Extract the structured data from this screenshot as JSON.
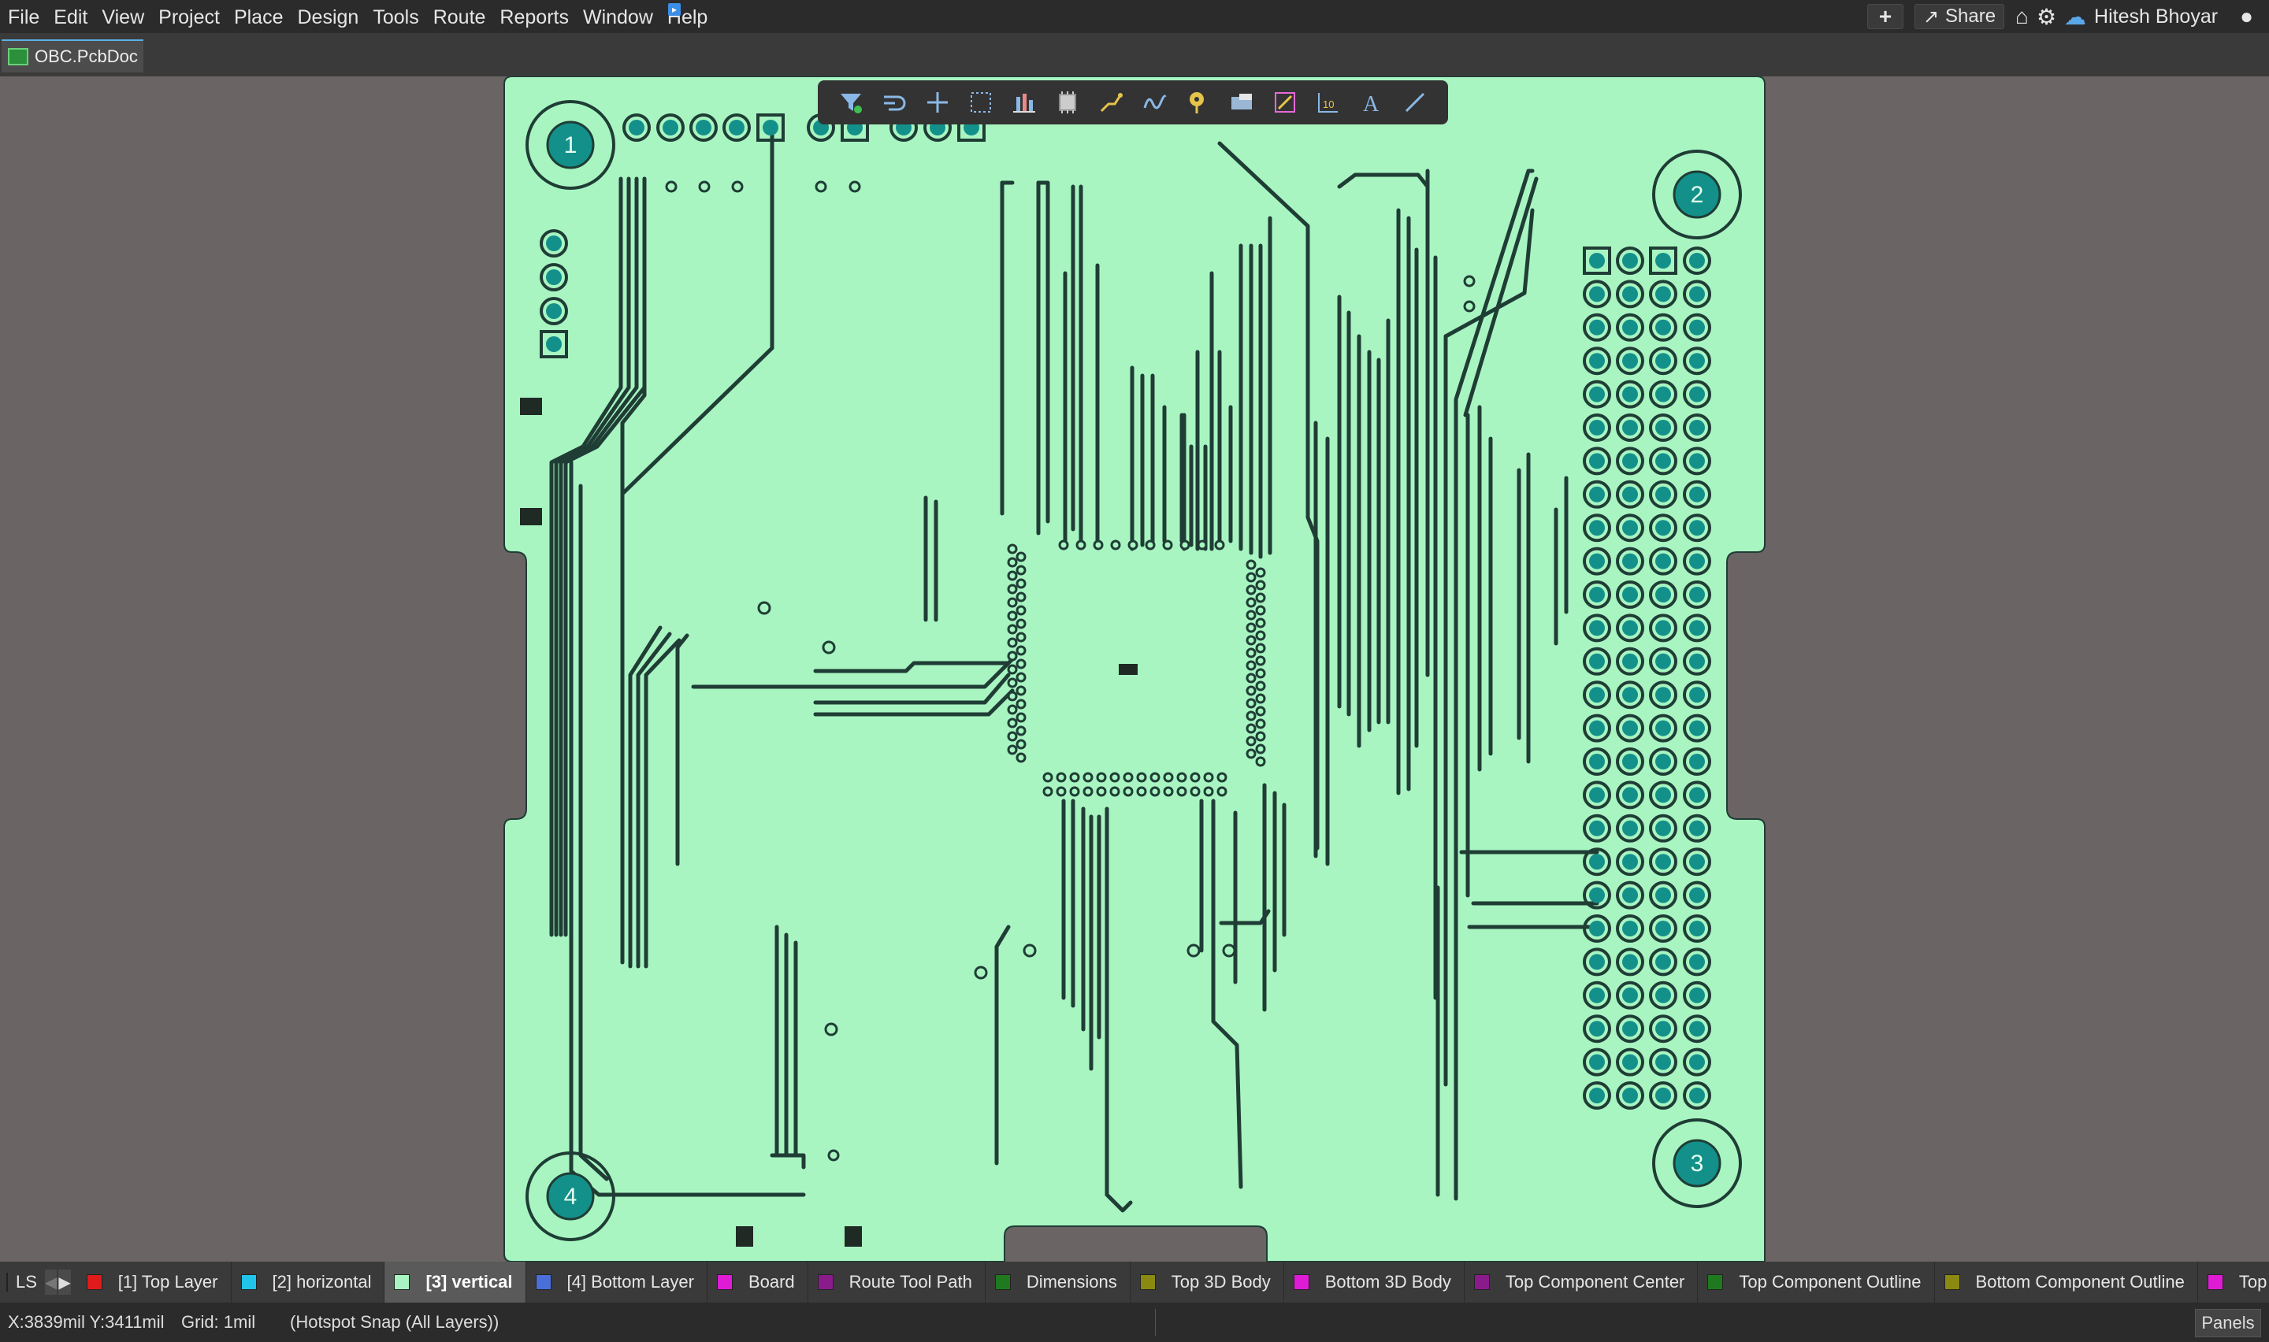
{
  "menu": {
    "items": [
      {
        "label": "File"
      },
      {
        "label": "Edit"
      },
      {
        "label": "View"
      },
      {
        "label": "Project"
      },
      {
        "label": "Place"
      },
      {
        "label": "Design"
      },
      {
        "label": "Tools"
      },
      {
        "label": "Route"
      },
      {
        "label": "Reports"
      },
      {
        "label": "Window"
      },
      {
        "label": "Help"
      }
    ]
  },
  "header_right": {
    "share_label": "Share",
    "user_name": "Hitesh Bhoyar",
    "icons": [
      "add-icon",
      "share-icon",
      "home-icon",
      "gear-icon",
      "cloud-user-icon",
      "account-icon"
    ]
  },
  "document_tab": {
    "label": "OBC.PcbDoc"
  },
  "board": {
    "mounting_holes": [
      "1",
      "2",
      "3",
      "4"
    ],
    "colors": {
      "board_fill": "#a8f5c2",
      "background": "#6b6464",
      "trace": "#1f3d35",
      "pad": "#13908a"
    }
  },
  "toolbar": {
    "tools": [
      "filter-icon",
      "interactive-route-icon",
      "cross-probe-icon",
      "select-rect-icon",
      "align-icon",
      "place-component-icon",
      "route-icon",
      "diff-pair-icon",
      "place-via-icon",
      "polygon-icon",
      "place-keepout-icon",
      "place-string-table-icon",
      "text-icon",
      "line-icon"
    ]
  },
  "layerbar": {
    "ls_label": "LS",
    "layers": [
      {
        "label": "[1] Top Layer",
        "color": "#e01b1b"
      },
      {
        "label": "[2] horizontal",
        "color": "#21c4ea"
      },
      {
        "label": "[3] vertical",
        "color": "#a8f5c2",
        "active": true
      },
      {
        "label": "[4] Bottom Layer",
        "color": "#4a6fd8"
      },
      {
        "label": "Board",
        "color": "#e01bd6"
      },
      {
        "label": "Route Tool Path",
        "color": "#8a1b8a"
      },
      {
        "label": "Dimensions",
        "color": "#1f7a1f"
      },
      {
        "label": "Top 3D Body",
        "color": "#8a8a12"
      },
      {
        "label": "Bottom 3D Body",
        "color": "#e01bd6"
      },
      {
        "label": "Top Component Center",
        "color": "#8a1b8a"
      },
      {
        "label": "Top Component Outline",
        "color": "#1f7a1f"
      },
      {
        "label": "Bottom Component Outline",
        "color": "#8a8a12"
      },
      {
        "label": "Top",
        "color": "#e01bd6"
      }
    ]
  },
  "status": {
    "coords": "X:3839mil Y:3411mil",
    "grid": "Grid: 1mil",
    "snap": "(Hotspot Snap (All Layers))",
    "panels_label": "Panels"
  }
}
